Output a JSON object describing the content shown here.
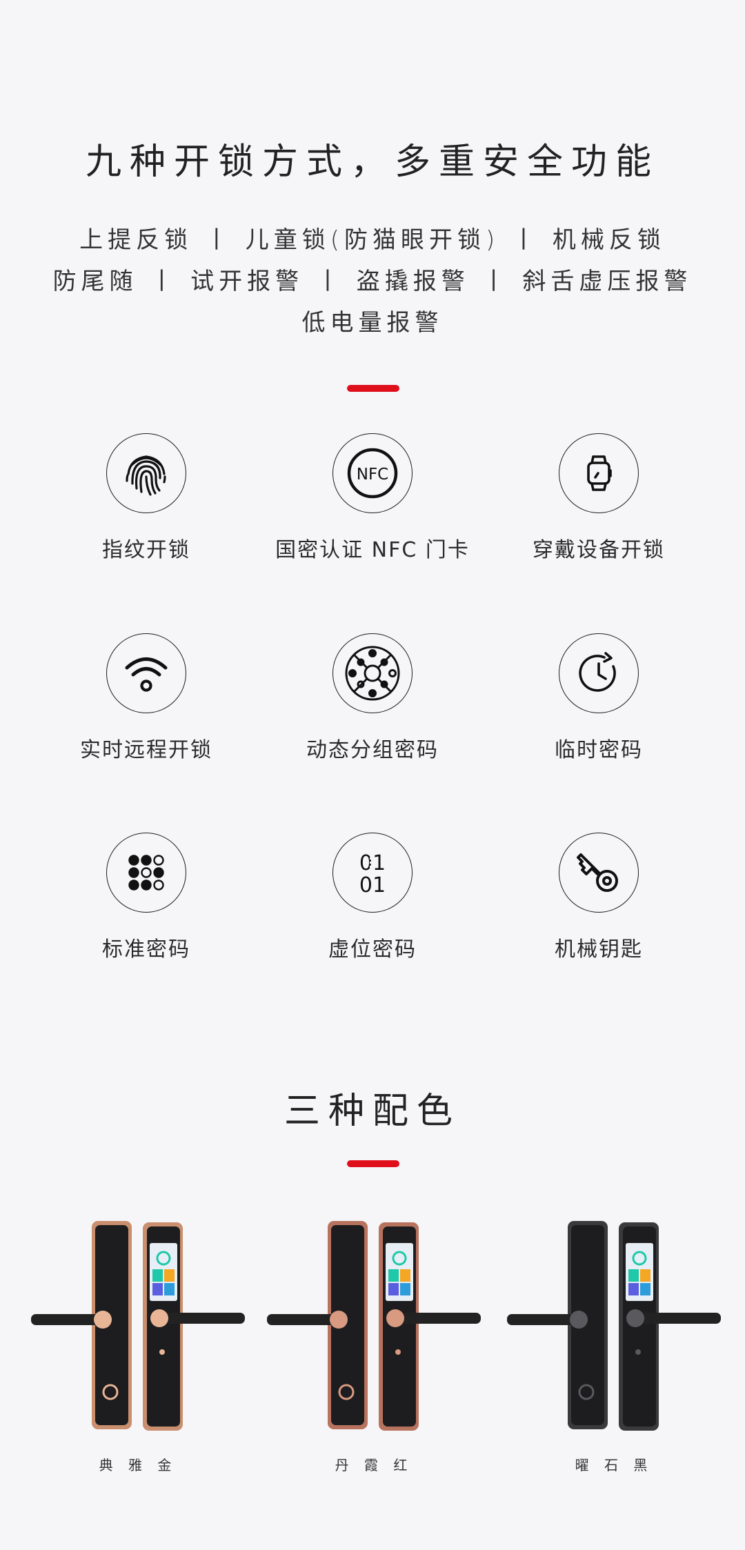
{
  "section1": {
    "title": "九种开锁方式，多重安全功能",
    "features_line1": "上提反锁 丨 儿童锁(防猫眼开锁) 丨 机械反锁",
    "features_line2": "防尾随 丨 试开报警 丨 盗撬报警 丨 斜舌虚压报警",
    "features_line3": "低电量报警",
    "accent_color": "#e00f1c"
  },
  "unlock_methods": [
    {
      "label": "指纹开锁",
      "icon": "fingerprint-icon"
    },
    {
      "label": "国密认证 NFC 门卡",
      "icon": "nfc-icon",
      "icon_text": "NFC"
    },
    {
      "label": "穿戴设备开锁",
      "icon": "smartwatch-icon"
    },
    {
      "label": "实时远程开锁",
      "icon": "wifi-icon"
    },
    {
      "label": "动态分组密码",
      "icon": "dynamic-code-icon"
    },
    {
      "label": "临时密码",
      "icon": "clock-icon"
    },
    {
      "label": "标准密码",
      "icon": "keypad-icon"
    },
    {
      "label": "虚位密码",
      "icon": "virtual-code-icon",
      "icon_text_top": "01",
      "icon_text_bottom": "01"
    },
    {
      "label": "机械钥匙",
      "icon": "key-icon"
    }
  ],
  "section2": {
    "title": "三种配色",
    "colors": [
      {
        "label": "典 雅 金",
        "body": "#c98f6e",
        "accent": "#e8b697"
      },
      {
        "label": "丹 霞 红",
        "body": "#b8735f",
        "accent": "#d99a82"
      },
      {
        "label": "曜 石 黑",
        "body": "#3a3a3d",
        "accent": "#5a5a5e"
      }
    ]
  }
}
